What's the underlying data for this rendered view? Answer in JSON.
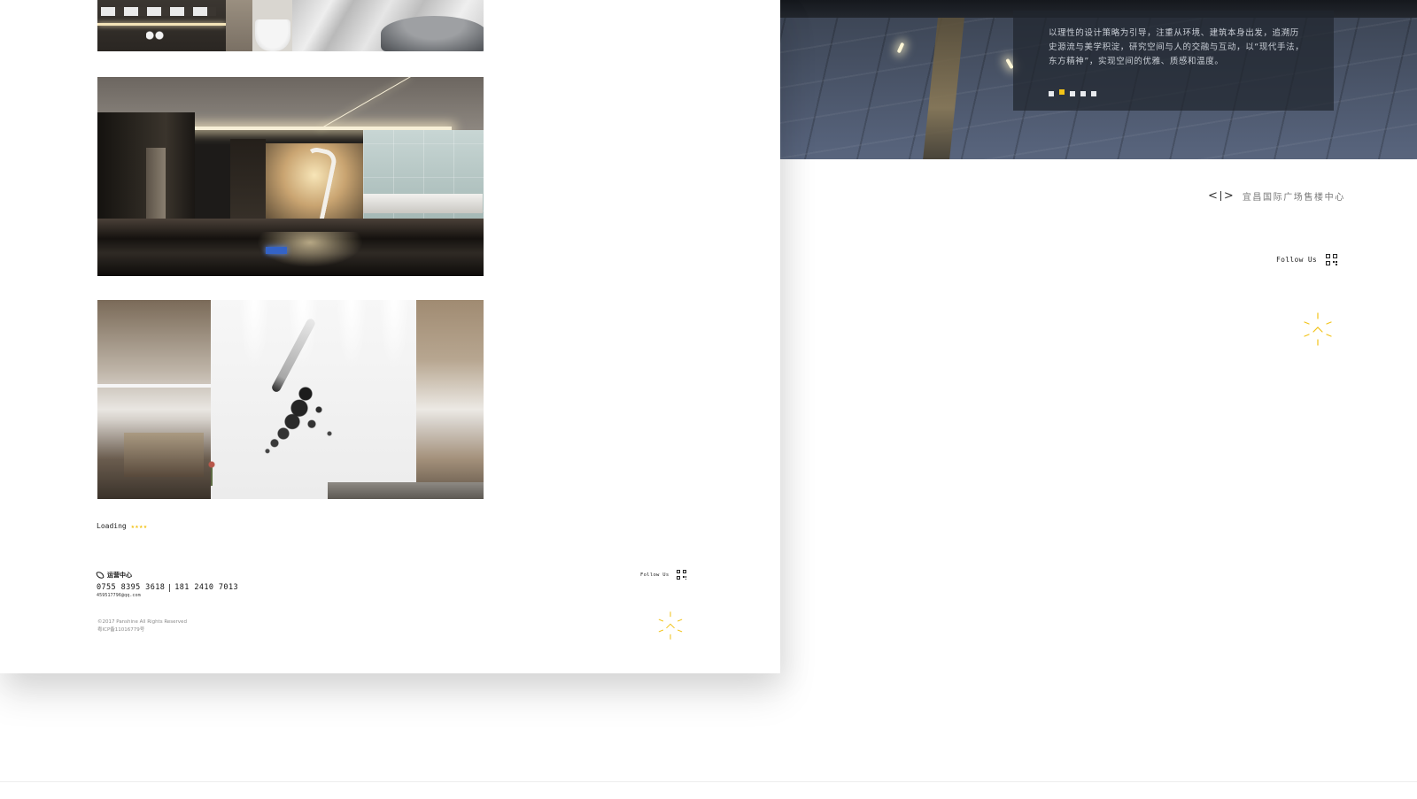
{
  "colors": {
    "accent": "#f2c318",
    "text_dark": "#222222",
    "text_muted": "#8a8a8a"
  },
  "left_page": {
    "gallery": [
      {
        "name": "bathroom-photo"
      },
      {
        "name": "lobby-photo"
      },
      {
        "name": "ink-sculpture-photo"
      }
    ],
    "loading": {
      "label": "Loading",
      "indicator": "★★★★"
    },
    "footer": {
      "contact_title": "运营中心",
      "phone_1": "0755 8395 3618",
      "phone_2": "181 2410 7013",
      "email": "459517796@qq.com",
      "copyright": "©2017 Panshine All Rights Reserved",
      "icp": "粤ICP备11016779号",
      "follow_label": "Follow Us",
      "qr_icon": "qr-code-icon",
      "to_top_icon": "back-to-top-icon"
    }
  },
  "right_page": {
    "hero": {
      "description": "以理性的设计策略为引导，注重从环境、建筑本身出发，追溯历史源流与美学积淀，研究空间与人的交融与互动，以“现代手法，东方精神”，实现空间的优雅、质感和温度。",
      "slides_total": 5,
      "active_slide": 2
    },
    "project_nav": {
      "prev_icon": "chevron-left-icon",
      "next_icon": "chevron-right-icon",
      "prev_symbol": "<",
      "next_symbol": ">",
      "project_name": "宜昌国际广场售楼中心"
    },
    "follow_label": "Follow Us",
    "qr_icon": "qr-code-icon",
    "to_top_icon": "back-to-top-icon"
  }
}
